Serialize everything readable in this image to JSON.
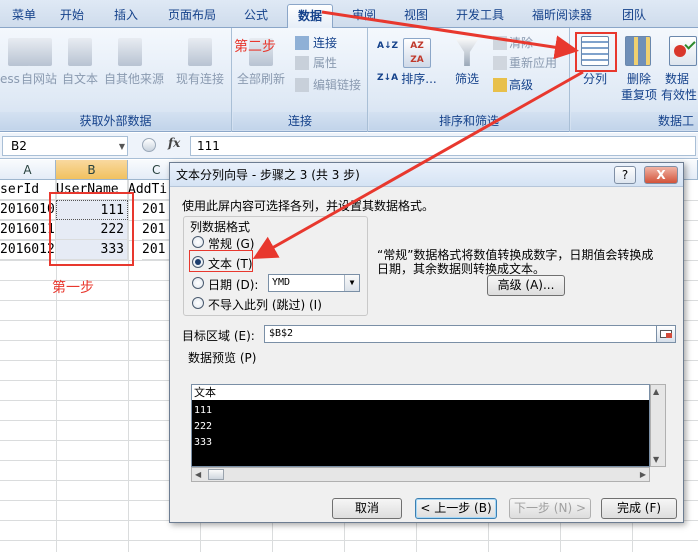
{
  "ribbon_tabs": [
    "菜单",
    "开始",
    "插入",
    "页面布局",
    "公式",
    "数据",
    "审阅",
    "视图",
    "开发工具",
    "福昕阅读器",
    "团队"
  ],
  "ribbon": {
    "group_external": {
      "label": "获取外部数据",
      "access": "ess",
      "web": "自网站",
      "text": "自文本",
      "other": "自其他来源",
      "existing": "现有连接"
    },
    "group_connections": {
      "label": "连接",
      "refresh_all": "全部刷新",
      "connections": "连接",
      "properties": "属性",
      "edit_links": "编辑链接"
    },
    "group_sort": {
      "label": "排序和筛选",
      "sort": "排序...",
      "filter": "筛选",
      "clear": "清除",
      "reapply": "重新应用",
      "advanced": "高级"
    },
    "group_tools": {
      "label": "数据工",
      "split": "分列",
      "remove_dup_1": "删除",
      "remove_dup_2": "重复项",
      "validation_1": "数据",
      "validation_2": "有效性"
    },
    "sort_az_icon": "A↓Z",
    "sort_za_icon": "Z↓A",
    "icons": [
      "sort-az-icon",
      "sort-za-icon",
      "filter-icon",
      "split-columns-icon",
      "remove-duplicates-icon",
      "data-validation-icon"
    ]
  },
  "formula_bar": {
    "name_box": "B2",
    "fx": "fx",
    "content": "111"
  },
  "sheet": {
    "col_headers": [
      "A",
      "B",
      "C"
    ],
    "header_row": [
      "serId",
      "UserName",
      "AddTi"
    ],
    "rows": [
      [
        "2016010",
        "111",
        "201"
      ],
      [
        "2016011",
        "222",
        "201"
      ],
      [
        "2016012",
        "333",
        "201"
      ]
    ]
  },
  "dialog": {
    "title": "文本分列向导 - 步骤之 3 (共 3 步)",
    "help_btn": "?",
    "close_btn": "X",
    "instruction": "使用此屏内容可选择各列，并设置其数据格式。",
    "format_legend": "列数据格式",
    "opt_general": "常规 (G)",
    "opt_text": "文本 (T)",
    "opt_date": "日期 (D):",
    "date_format": "YMD",
    "opt_skip": "不导入此列 (跳过) (I)",
    "general_desc_1": "“常规”数据格式将数值转换成数字，日期值会转换成",
    "general_desc_2": "日期，其余数据则转换成文本。",
    "advanced_btn": "高级 (A)...",
    "target_label": "目标区域 (E):",
    "target_value": "$B$2",
    "preview_label": "数据预览 (P)",
    "preview_header": "文本",
    "preview_rows": [
      "111",
      "222",
      "333"
    ],
    "cancel": "取消",
    "back": "< 上一步 (B)",
    "next": "下一步 (N) >",
    "finish": "完成 (F)"
  },
  "annotations": {
    "step1": "第一步",
    "step2": "第二步",
    "color": "#e8382e"
  }
}
